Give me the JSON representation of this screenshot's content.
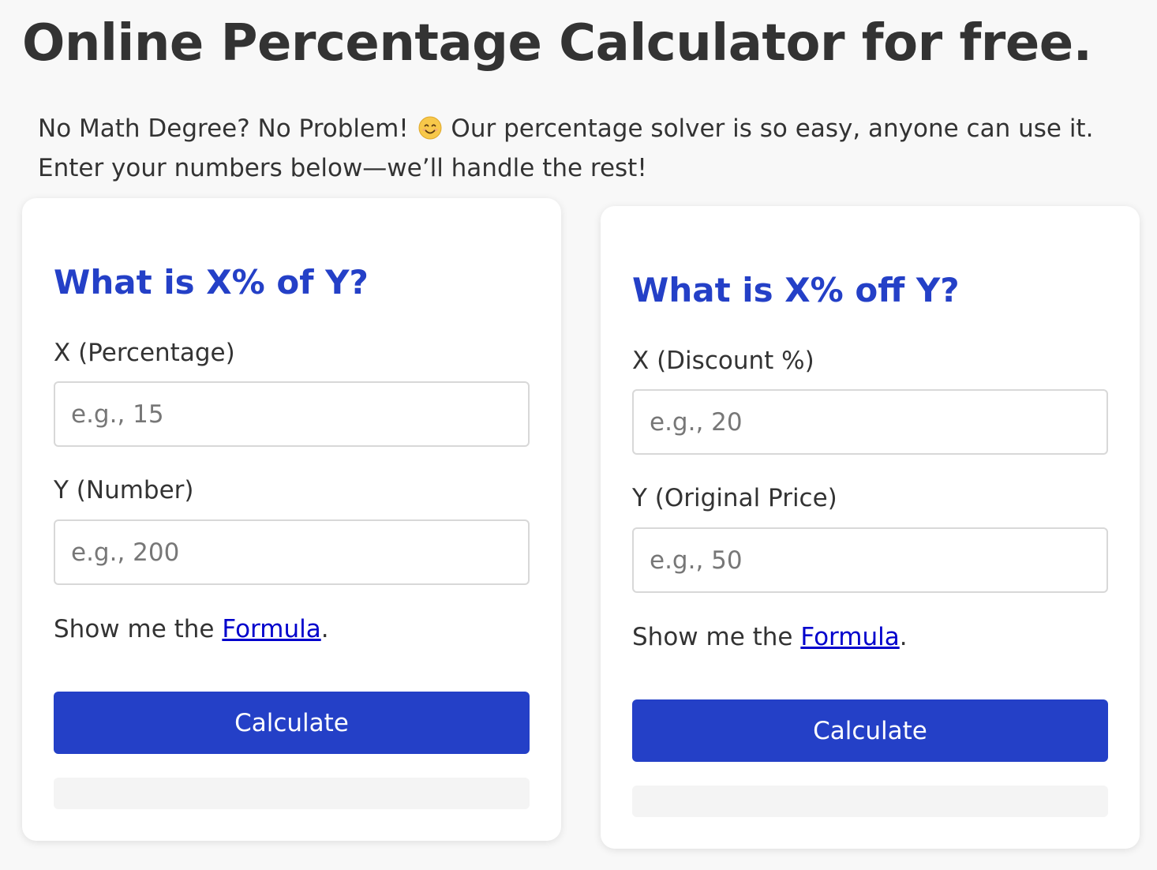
{
  "page": {
    "title": "Online Percentage Calculator for free.",
    "intro_before_emoji": "No Math Degree? No Problem! ",
    "intro_after_emoji": " Our percentage solver is so easy, anyone can use it. Enter your numbers below—we’ll handle the rest!",
    "emoji_icon": "smiling-face-icon"
  },
  "calculators": [
    {
      "title": "What is X% of Y?",
      "x_label": "X (Percentage)",
      "x_placeholder": "e.g., 15",
      "x_value": "",
      "y_label": "Y (Number)",
      "y_placeholder": "e.g., 200",
      "y_value": "",
      "formula_prefix": "Show me the ",
      "formula_link": "Formula",
      "formula_suffix": ".",
      "button_label": "Calculate",
      "result": ""
    },
    {
      "title": "What is X% off Y?",
      "x_label": "X (Discount %)",
      "x_placeholder": "e.g., 20",
      "x_value": "",
      "y_label": "Y (Original Price)",
      "y_placeholder": "e.g., 50",
      "y_value": "",
      "formula_prefix": "Show me the ",
      "formula_link": "Formula",
      "formula_suffix": ".",
      "button_label": "Calculate",
      "result": ""
    }
  ],
  "colors": {
    "accent": "#2440c7",
    "link": "#0000cc",
    "text": "#333333",
    "background": "#f8f8f8"
  }
}
